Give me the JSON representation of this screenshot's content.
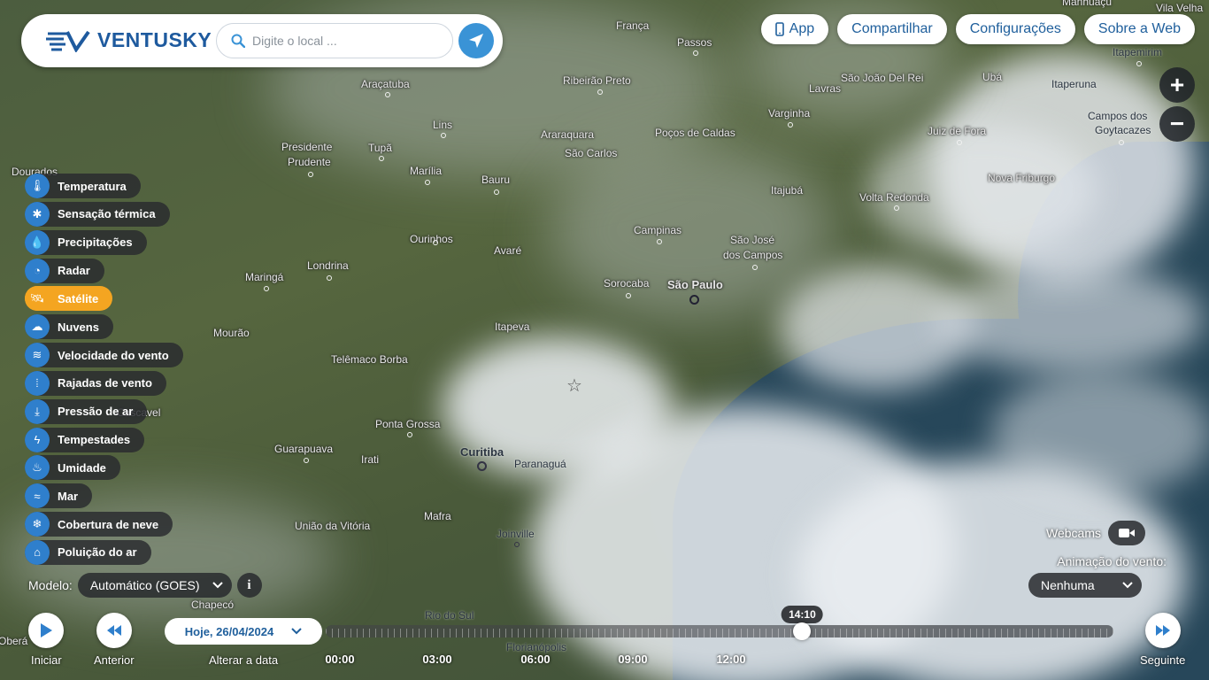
{
  "app": {
    "logo": "VENTUSKY"
  },
  "search": {
    "placeholder": "Digite o local ..."
  },
  "topnav": {
    "app": "App",
    "share": "Compartilhar",
    "settings": "Configurações",
    "about": "Sobre a Web"
  },
  "zoom": {
    "in": "+",
    "out": "−"
  },
  "layers": [
    {
      "label": "Temperatura",
      "icon": "thermometer-icon",
      "glyph": "🌡"
    },
    {
      "label": "Sensação térmica",
      "icon": "feels-like-icon",
      "glyph": "✱"
    },
    {
      "label": "Precipitações",
      "icon": "drop-icon",
      "glyph": "💧"
    },
    {
      "label": "Radar",
      "icon": "radar-icon",
      "glyph": "◔"
    },
    {
      "label": "Satélite",
      "icon": "satellite-icon",
      "glyph": "🛰",
      "active": true
    },
    {
      "label": "Nuvens",
      "icon": "cloud-icon",
      "glyph": "☁"
    },
    {
      "label": "Velocidade do vento",
      "icon": "wind-icon",
      "glyph": "≋"
    },
    {
      "label": "Rajadas de vento",
      "icon": "gust-icon",
      "glyph": "⦙"
    },
    {
      "label": "Pressão de ar",
      "icon": "pressure-icon",
      "glyph": "⤓"
    },
    {
      "label": "Tempestades",
      "icon": "lightning-icon",
      "glyph": "ϟ"
    },
    {
      "label": "Umidade",
      "icon": "humidity-icon",
      "glyph": "♨"
    },
    {
      "label": "Mar",
      "icon": "waves-icon",
      "glyph": "≈"
    },
    {
      "label": "Cobertura de neve",
      "icon": "snowflake-icon",
      "glyph": "❄"
    },
    {
      "label": "Poluição do ar",
      "icon": "factory-icon",
      "glyph": "⌂"
    }
  ],
  "model": {
    "label": "Modelo:",
    "value": "Automático (GOES)",
    "info": "i"
  },
  "webcams": {
    "label": "Webcams"
  },
  "wind_animation": {
    "label": "Animação do vento:",
    "value": "Nenhuma"
  },
  "timeline": {
    "play": "Iniciar",
    "previous": "Anterior",
    "change_date": "Alterar a data",
    "date": "Hoje, 26/04/2024",
    "next": "Seguinte",
    "current_time": "14:10",
    "progress": 0.605,
    "hours": [
      "00:00",
      "03:00",
      "06:00",
      "09:00",
      "12:00"
    ]
  },
  "map_labels": [
    "Dourados",
    "França",
    "Passos",
    "Vila Velha",
    "Manhuaçu",
    "Itapemirim",
    "Araçatuba",
    "Ribeirão Preto",
    "São João Del Rei",
    "Ubá",
    "Itaperuna",
    "Lavras",
    "Campos dos",
    "Goytacazes",
    "Lins",
    "Araraquara",
    "São Carlos",
    "Poços de Caldas",
    "Varginha",
    "Juiz de Fora",
    "Presidente",
    "Prudente",
    "Tupã",
    "Marília",
    "Bauru",
    "Itajubá",
    "Nova Friburgo",
    "Volta Redonda",
    "Campinas",
    "São José",
    "dos Campos",
    "Ourinhos",
    "Avaré",
    "Londrina",
    "Maringá",
    "Sorocaba",
    "São Paulo",
    "Mourão",
    "Itapeva",
    "Telêmaco Borba",
    "Ponta Grossa",
    "Guarapuava",
    "Irati",
    "Curitiba",
    "Paranaguá",
    "Mafra",
    "União da Vitória",
    "Joinville",
    "Chapecó",
    "Rio do Sul",
    "Florianópolis",
    "Oberá",
    "Cascavel"
  ]
}
